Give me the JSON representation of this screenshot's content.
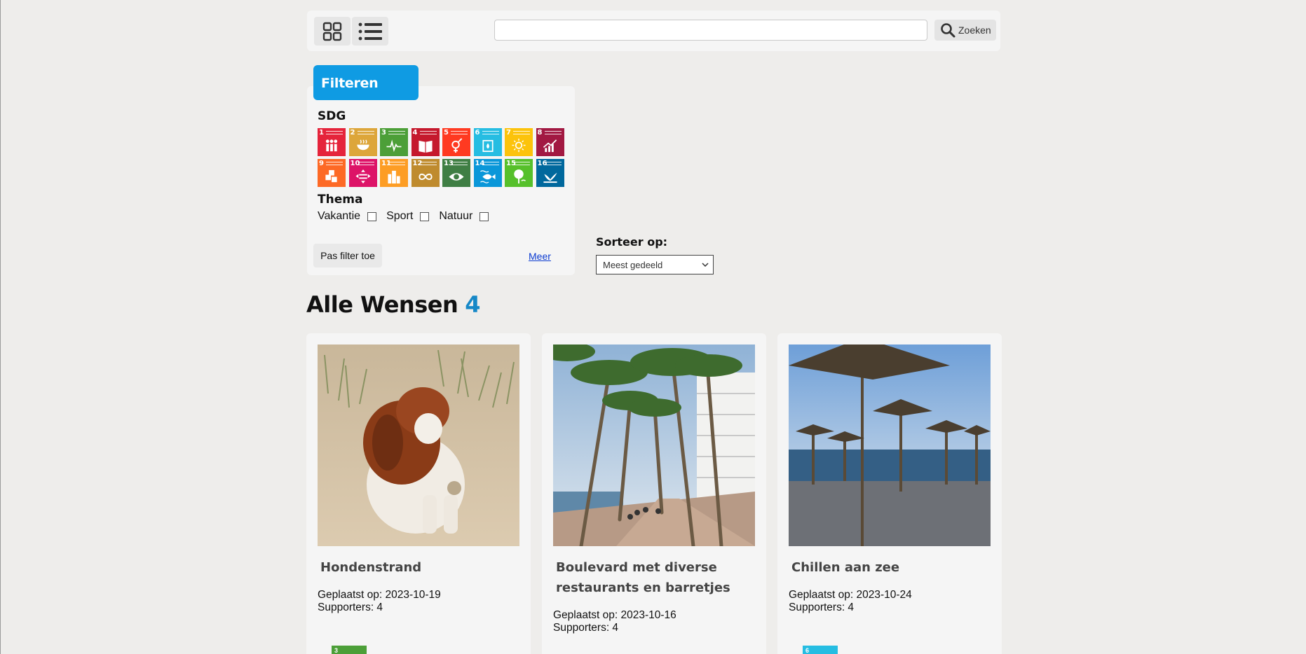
{
  "toolbar": {
    "grid_icon": "grid-view-icon",
    "list_icon": "list-view-icon",
    "search": {
      "value": "",
      "placeholder": "",
      "button_label": "Zoeken",
      "icon": "search-icon"
    }
  },
  "filter": {
    "tab_label": "Filteren",
    "sdg_title": "SDG",
    "sdg_tiles": [
      {
        "num": "1",
        "color": "#e5243b",
        "icon": "family-icon"
      },
      {
        "num": "2",
        "color": "#dda63a",
        "icon": "bowl-icon"
      },
      {
        "num": "3",
        "color": "#4c9f38",
        "icon": "heartbeat-icon"
      },
      {
        "num": "4",
        "color": "#c5192d",
        "icon": "book-icon"
      },
      {
        "num": "5",
        "color": "#ff3a21",
        "icon": "gender-icon"
      },
      {
        "num": "6",
        "color": "#26bde2",
        "icon": "water-icon"
      },
      {
        "num": "7",
        "color": "#fcc30b",
        "icon": "sun-icon"
      },
      {
        "num": "8",
        "color": "#a21942",
        "icon": "growth-chart-icon"
      },
      {
        "num": "9",
        "color": "#fd6925",
        "icon": "cubes-icon"
      },
      {
        "num": "10",
        "color": "#dd1367",
        "icon": "equality-icon"
      },
      {
        "num": "11",
        "color": "#fd9d24",
        "icon": "city-icon"
      },
      {
        "num": "12",
        "color": "#bf8b2e",
        "icon": "infinity-icon"
      },
      {
        "num": "13",
        "color": "#3f7e44",
        "icon": "eye-globe-icon"
      },
      {
        "num": "14",
        "color": "#0a97d9",
        "icon": "fish-icon"
      },
      {
        "num": "15",
        "color": "#56c02b",
        "icon": "tree-icon"
      },
      {
        "num": "16",
        "color": "#00689d",
        "icon": "dove-icon"
      }
    ],
    "thema_title": "Thema",
    "thema_options": [
      "Vakantie",
      "Sport",
      "Natuur"
    ],
    "apply_label": "Pas filter toe",
    "more_label": "Meer"
  },
  "sort": {
    "label": "Sorteer op:",
    "selected": "Meest gedeeld"
  },
  "heading": {
    "title": "Alle Wensen",
    "count": "4"
  },
  "cards": [
    {
      "title": "Hondenstrand",
      "date": "Geplaatst op: 2023-10-19",
      "supporters": "Supporters: 4",
      "sdg": "3",
      "sdg_color": "#4c9f38",
      "image": "dog-on-beach-photo"
    },
    {
      "title": "Boulevard met diverse restaurants en barretjes a...",
      "date": "Geplaatst op: 2023-10-16",
      "supporters": "Supporters: 4",
      "sdg": "",
      "sdg_color": "",
      "image": "palm-boulevard-photo"
    },
    {
      "title": "Chillen aan zee",
      "date": "Geplaatst op: 2023-10-24",
      "supporters": "Supporters: 4",
      "sdg": "6",
      "sdg_color": "#26bde2",
      "image": "beach-umbrellas-photo"
    }
  ]
}
